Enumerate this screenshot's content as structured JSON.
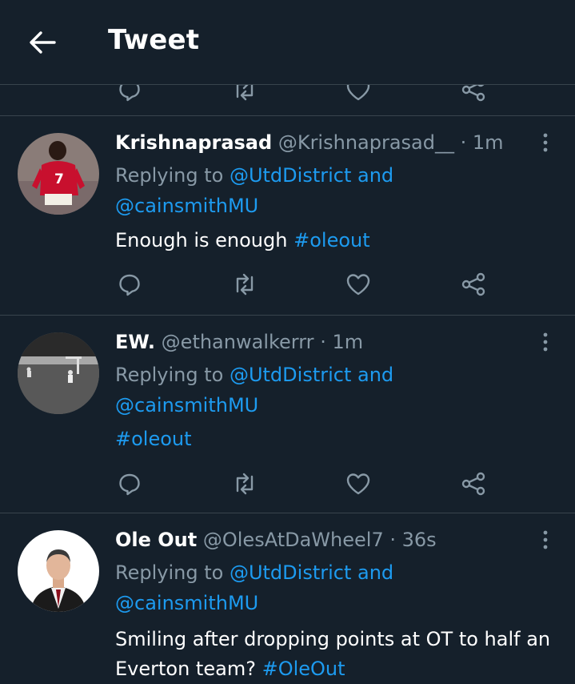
{
  "header": {
    "title": "Tweet",
    "back_icon": "arrow-left-icon"
  },
  "colors": {
    "background": "#15202b",
    "accent": "#1d9bf0",
    "secondary_text": "#8899a6",
    "divider": "#38444d"
  },
  "tweets": [
    {
      "name": "Krishnaprasad",
      "handle": "@Krishnaprasad__",
      "time": "· 1m",
      "replying_prefix": "Replying to",
      "replying_user1": "@UtdDistrict",
      "replying_and": "and",
      "replying_user2": "@cainsmithMU",
      "text": "Enough is enough",
      "hashtag": "#oleout"
    },
    {
      "name": "EW.",
      "handle": "@ethanwalkerrr",
      "time": "· 1m",
      "replying_prefix": "Replying to",
      "replying_user1": "@UtdDistrict",
      "replying_and": "and",
      "replying_user2": "@cainsmithMU",
      "text": "",
      "hashtag": "#oleout"
    },
    {
      "name": "Ole Out",
      "handle": "@OlesAtDaWheel7",
      "time": "· 36s",
      "replying_prefix": "Replying to",
      "replying_user1": "@UtdDistrict",
      "replying_and": "and",
      "replying_user2": "@cainsmithMU",
      "text": "Smiling after dropping points at OT to half an Everton team?",
      "hashtag": "#OleOut"
    }
  ],
  "action_icons": [
    "reply-icon",
    "retweet-icon",
    "like-icon",
    "share-icon"
  ]
}
